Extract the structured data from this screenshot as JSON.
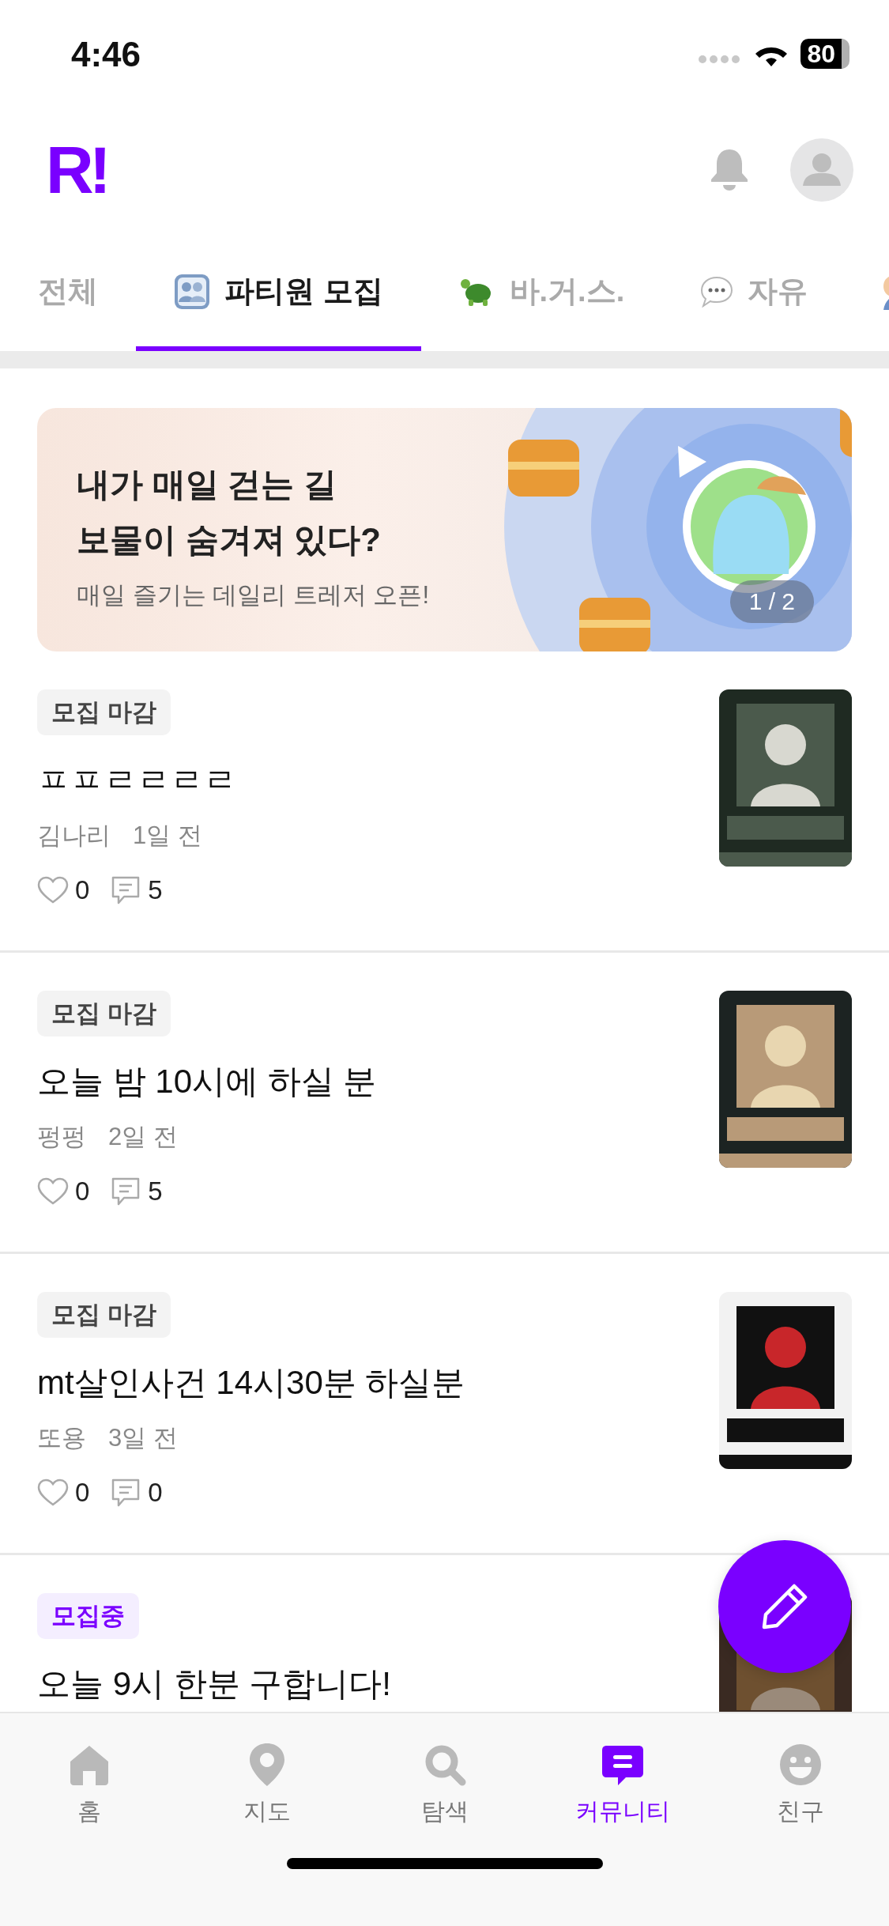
{
  "status_bar": {
    "time": "4:46",
    "battery": "80"
  },
  "header": {
    "logo": "R!"
  },
  "tabs": [
    {
      "label": "전체",
      "selected": false
    },
    {
      "label": "파티원 모집",
      "selected": true
    },
    {
      "label": "바.거.스.",
      "selected": false
    },
    {
      "label": "자유",
      "selected": false
    },
    {
      "selected": false
    }
  ],
  "banner": {
    "title_lines": [
      "내가 매일 걷는 길",
      "보물이 숨겨져 있다?"
    ],
    "subtitle": "매일 즐기는 데일리 트레저 오픈!",
    "pager": "1 / 2"
  },
  "posts": [
    {
      "status": "모집 마감",
      "recruiting": false,
      "title": "ㅍㅍㄹㄹㄹㄹ",
      "author": "김나리",
      "time": "1일 전",
      "likes": "0",
      "comments": "5"
    },
    {
      "status": "모집 마감",
      "recruiting": false,
      "title": "오늘 밤 10시에 하실 분",
      "author": "펑펑",
      "time": "2일 전",
      "likes": "0",
      "comments": "5"
    },
    {
      "status": "모집 마감",
      "recruiting": false,
      "title": "mt살인사건 14시30분 하실분",
      "author": "또용",
      "time": "3일 전",
      "likes": "0",
      "comments": "0"
    },
    {
      "status": "모집중",
      "recruiting": true,
      "title": "오늘 9시 한분 구합니다!"
    }
  ],
  "bottom_nav": [
    {
      "label": "홈",
      "selected": false
    },
    {
      "label": "지도",
      "selected": false
    },
    {
      "label": "탐색",
      "selected": false
    },
    {
      "label": "커뮤니티",
      "selected": true
    },
    {
      "label": "친구",
      "selected": false
    }
  ]
}
